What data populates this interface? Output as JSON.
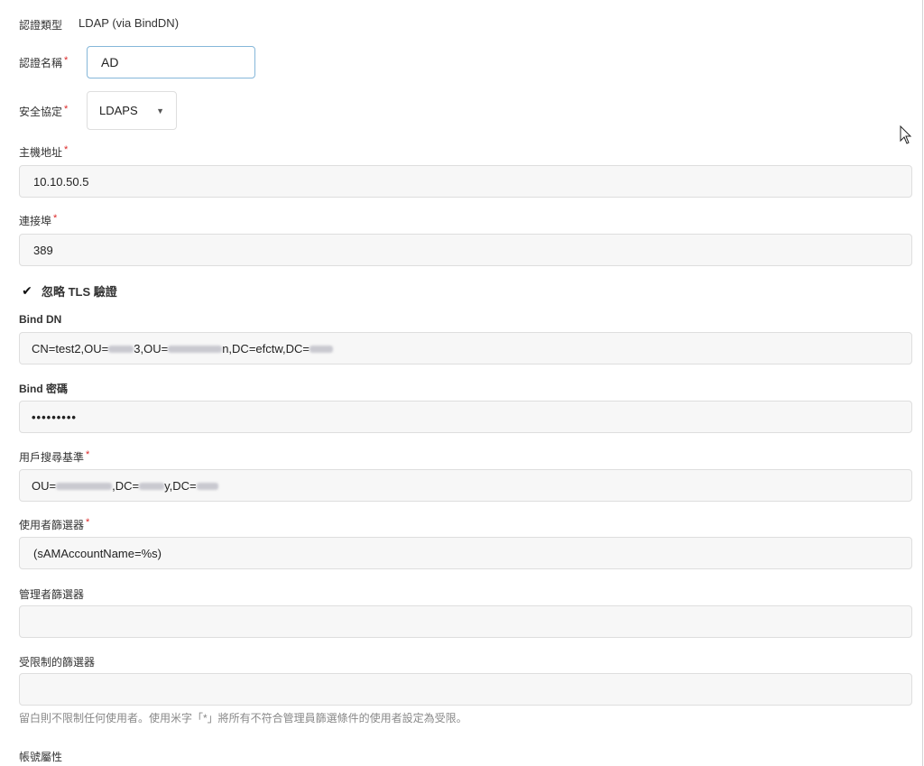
{
  "auth_type": {
    "label": "認證類型",
    "value": "LDAP (via BindDN)"
  },
  "auth_name": {
    "label": "認證名稱",
    "value": "AD"
  },
  "security_protocol": {
    "label": "安全協定",
    "selected": "LDAPS"
  },
  "host": {
    "label": "主機地址",
    "value": "10.10.50.5"
  },
  "port": {
    "label": "連接埠",
    "value": "389"
  },
  "skip_tls": {
    "label": "忽略 TLS 驗證",
    "checked": true
  },
  "bind_dn": {
    "label": "Bind DN",
    "value_parts": [
      "CN=test2,OU=",
      "3,OU=",
      "n,DC=efctw,DC="
    ]
  },
  "bind_password": {
    "label": "Bind 密碼",
    "value": "•••••••••"
  },
  "user_search_base": {
    "label": "用戶搜尋基準",
    "value_parts": [
      "OU=",
      ",DC=",
      "y,DC="
    ]
  },
  "user_filter": {
    "label": "使用者篩選器",
    "value": "(sAMAccountName=%s)"
  },
  "admin_filter": {
    "label": "管理者篩選器",
    "value": ""
  },
  "restricted_filter": {
    "label": "受限制的篩選器",
    "value": "",
    "hint": "留白則不限制任何使用者。使用米字「*」將所有不符合管理員篩選條件的使用者設定為受限。"
  },
  "account_attribute": {
    "label": "帳號屬性"
  },
  "required_mark": "*",
  "colors": {
    "required": "#db2828",
    "focus_border": "#85b7d9",
    "field_bg": "#f7f7f7"
  },
  "icons": {
    "dropdown": "caret-down-icon",
    "checkbox": "check-icon",
    "cursor": "mouse-pointer-icon"
  }
}
